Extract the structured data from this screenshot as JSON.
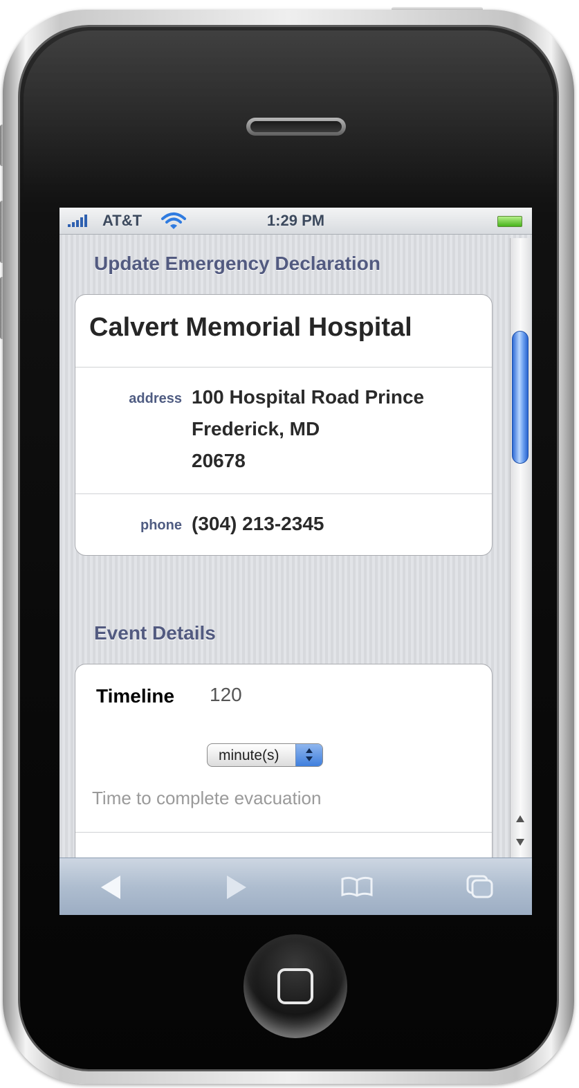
{
  "status_bar": {
    "carrier": "AT&T",
    "time": "1:29 PM"
  },
  "page": {
    "title": "Update Emergency Declaration"
  },
  "hospital": {
    "name": "Calvert Memorial Hospital",
    "address_label": "address",
    "address_line1": "100 Hospital Road Prince",
    "address_line2": "Frederick, MD",
    "address_line3": "20678",
    "phone_label": "phone",
    "phone": "(304) 213-2345"
  },
  "event_details": {
    "title": "Event Details",
    "timeline_label": "Timeline",
    "timeline_value": "120",
    "unit_selected": "minute(s)",
    "hint": "Time to complete evacuation"
  },
  "toolbar": {
    "icons": [
      "back-icon",
      "forward-icon",
      "bookmarks-icon",
      "pages-icon"
    ]
  }
}
